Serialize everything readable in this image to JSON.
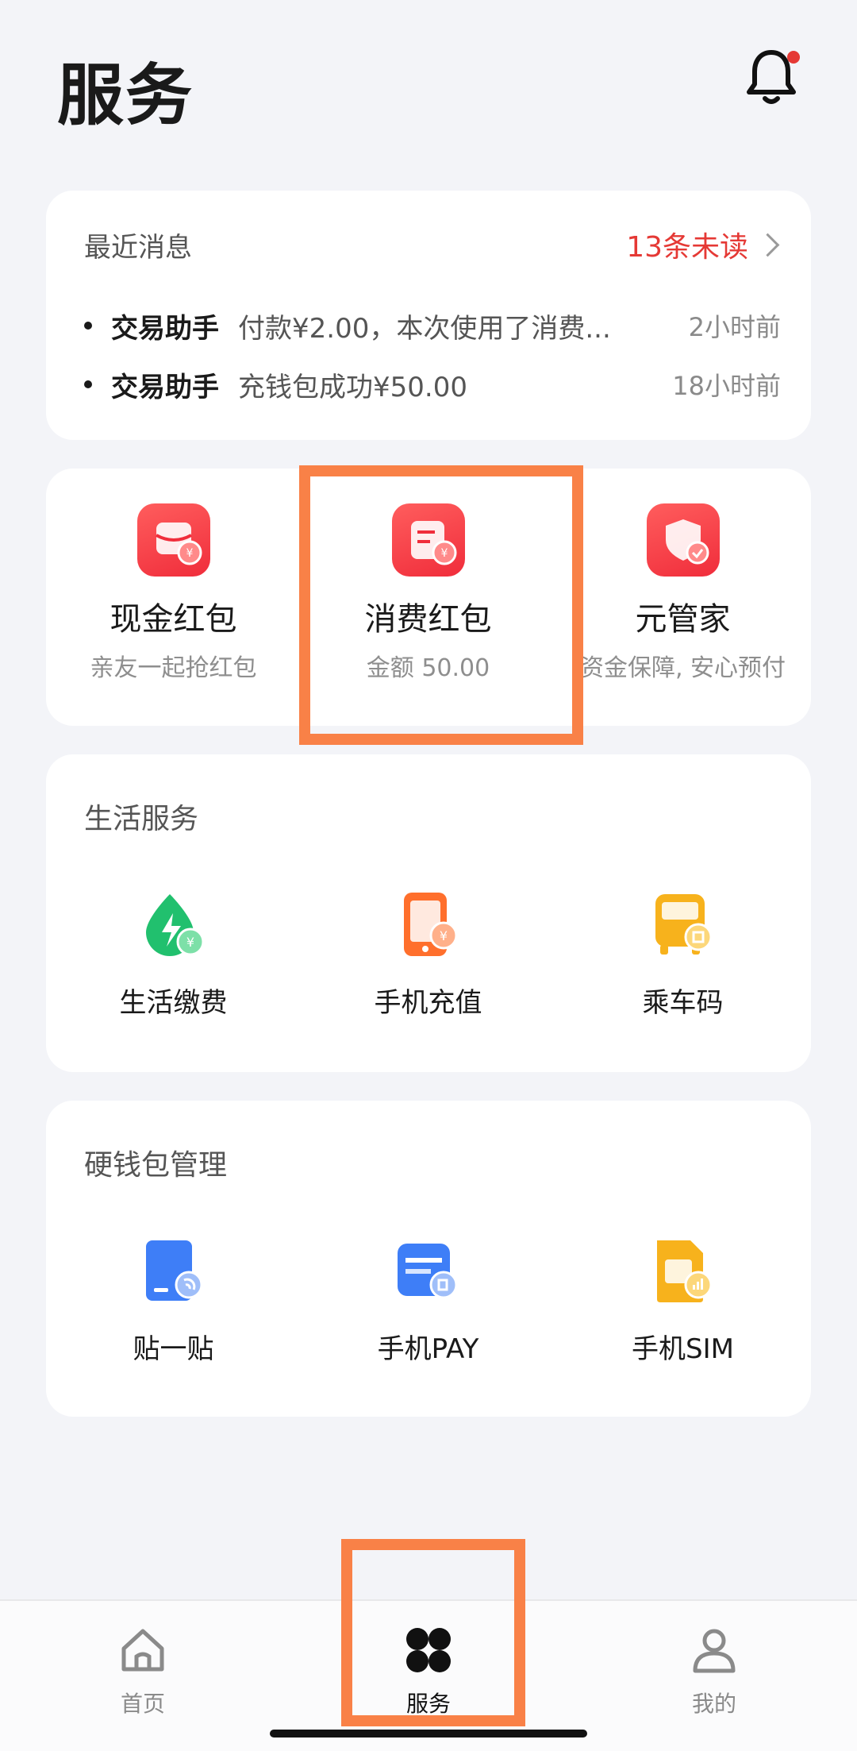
{
  "header": {
    "title": "服务"
  },
  "messages": {
    "heading": "最近消息",
    "unread": "13条未读",
    "items": [
      {
        "sender": "交易助手",
        "text": "付款¥2.00，本次使用了消费...",
        "time": "2小时前"
      },
      {
        "sender": "交易助手",
        "text": "充钱包成功¥50.00",
        "time": "18小时前"
      }
    ]
  },
  "features": [
    {
      "name": "现金红包",
      "sub": "亲友一起抢红包"
    },
    {
      "name": "消费红包",
      "sub": "金额 50.00"
    },
    {
      "name": "元管家",
      "sub": "资金保障, 安心预付"
    }
  ],
  "life": {
    "title": "生活服务",
    "items": [
      {
        "label": "生活缴费"
      },
      {
        "label": "手机充值"
      },
      {
        "label": "乘车码"
      }
    ]
  },
  "hardwallet": {
    "title": "硬钱包管理",
    "items": [
      {
        "label": "贴一贴"
      },
      {
        "label": "手机PAY"
      },
      {
        "label": "手机SIM"
      }
    ]
  },
  "tabbar": {
    "items": [
      {
        "label": "首页"
      },
      {
        "label": "服务"
      },
      {
        "label": "我的"
      }
    ],
    "active": "服务"
  },
  "colors": {
    "accent_red": "#e53935",
    "highlight": "#f98147",
    "life_green": "#21c06e",
    "phone_orange": "#ff6f2c",
    "bus_yellow": "#f7b21c",
    "wallet_blue": "#3e7ef7"
  }
}
